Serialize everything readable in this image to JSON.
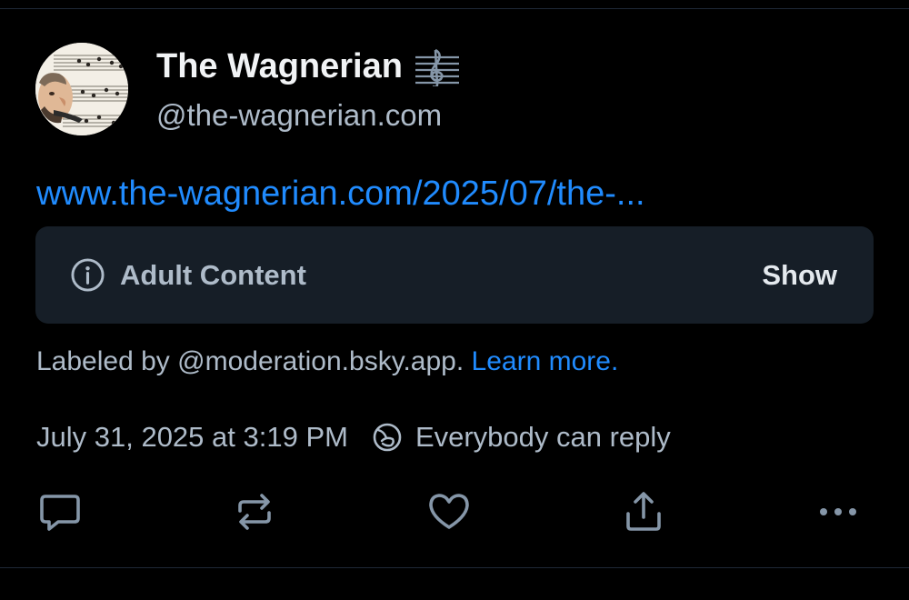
{
  "post": {
    "author": {
      "display_name": "The Wagnerian",
      "handle": "@the-wagnerian.com",
      "badge_icon": "treble-clef-icon"
    },
    "link_text": "www.the-wagnerian.com/2025/07/the-...",
    "content_warning": {
      "icon": "info-icon",
      "label": "Adult Content",
      "show_label": "Show"
    },
    "labeled_by": {
      "prefix": "Labeled by @moderation.bsky.app.",
      "learn_more": "Learn more."
    },
    "timestamp": "July 31, 2025 at 3:19 PM",
    "reply_setting": "Everybody can reply",
    "actions": [
      "reply-icon",
      "repost-icon",
      "like-icon",
      "share-icon",
      "more-icon"
    ]
  },
  "colors": {
    "background": "#000000",
    "link": "#208bfe",
    "muted_text": "#aebbc9",
    "card_bg": "#161e27"
  }
}
